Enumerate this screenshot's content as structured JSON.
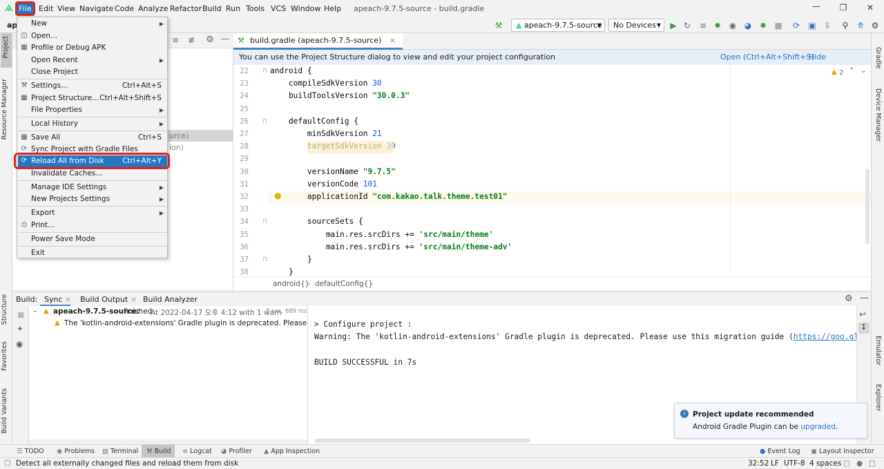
{
  "menubar": {
    "items": [
      "File",
      "Edit",
      "View",
      "Navigate",
      "Code",
      "Analyze",
      "Refactor",
      "Build",
      "Run",
      "Tools",
      "VCS",
      "Window",
      "Help"
    ],
    "window_title": "apeach-9.7.5-source - build.gradle"
  },
  "toolbar": {
    "project_crumb": "ape",
    "run_config": "apeach-9.7.5-source",
    "device": "No Devices"
  },
  "file_menu": {
    "new": "New",
    "open": "Open...",
    "profile_debug_apk": "Profile or Debug APK",
    "open_recent": "Open Recent",
    "close_project": "Close Project",
    "settings": "Settings...",
    "settings_sc": "Ctrl+Alt+S",
    "project_structure": "Project Structure...",
    "project_structure_sc": "Ctrl+Alt+Shift+S",
    "file_properties": "File Properties",
    "local_history": "Local History",
    "save_all": "Save All",
    "save_all_sc": "Ctrl+S",
    "sync_gradle": "Sync Project with Gradle Files",
    "reload_all": "Reload All from Disk",
    "reload_all_sc": "Ctrl+Alt+Y",
    "invalidate_caches": "Invalidate Caches...",
    "manage_ide": "Manage IDE Settings",
    "new_projects_settings": "New Projects Settings",
    "export": "Export",
    "print": "Print...",
    "power_save": "Power Save Mode",
    "exit": "Exit"
  },
  "project_pane": {
    "partial_1": "urce)",
    "partial_2": "ion)"
  },
  "left_strip": {
    "project": "Project",
    "resource_manager": "Resource Manager",
    "structure": "Structure",
    "favorites": "Favorites",
    "build_variants": "Build Variants"
  },
  "right_strip": {
    "gradle": "Gradle",
    "device_manager": "Device Manager",
    "emulator": "Emulator",
    "device_file_explorer": "Device File Explorer"
  },
  "editor": {
    "tab_label": "build.gradle (apeach-9.7.5-source)",
    "notification": "You can use the Project Structure dialog to view and edit your project configuration",
    "open_link": "Open (Ctrl+Alt+Shift+S)",
    "hide_link": "Hide notification",
    "warning_count": "2",
    "lines": [
      {
        "n": "22",
        "parts": [
          {
            "t": "android {",
            "c": ""
          }
        ]
      },
      {
        "n": "23",
        "parts": [
          {
            "t": "    compileSdkVersion ",
            "c": ""
          },
          {
            "t": "30",
            "c": "kw-num"
          }
        ]
      },
      {
        "n": "24",
        "parts": [
          {
            "t": "    buildToolsVersion ",
            "c": ""
          },
          {
            "t": "\"30.0.3\"",
            "c": "kw-str"
          }
        ]
      },
      {
        "n": "25",
        "parts": [
          {
            "t": "",
            "c": ""
          }
        ]
      },
      {
        "n": "26",
        "parts": [
          {
            "t": "    defaultConfig {",
            "c": ""
          }
        ]
      },
      {
        "n": "27",
        "parts": [
          {
            "t": "        minSdkVersion ",
            "c": ""
          },
          {
            "t": "21",
            "c": "kw-num"
          }
        ]
      },
      {
        "n": "28",
        "parts": [
          {
            "t": "        targetSdkVersion ",
            "c": ""
          },
          {
            "t": "30",
            "c": "kw-num"
          }
        ]
      },
      {
        "n": "29",
        "parts": [
          {
            "t": "",
            "c": ""
          }
        ]
      },
      {
        "n": "30",
        "parts": [
          {
            "t": "        versionName ",
            "c": ""
          },
          {
            "t": "\"9.7.5\"",
            "c": "kw-str"
          }
        ]
      },
      {
        "n": "31",
        "parts": [
          {
            "t": "        versionCode ",
            "c": ""
          },
          {
            "t": "101",
            "c": "kw-num"
          }
        ]
      },
      {
        "n": "32",
        "parts": [
          {
            "t": "        applicationId ",
            "c": ""
          },
          {
            "t": "\"com.kakao.talk.theme.test01\"",
            "c": "kw-str"
          }
        ]
      },
      {
        "n": "33",
        "parts": [
          {
            "t": "",
            "c": ""
          }
        ]
      },
      {
        "n": "34",
        "parts": [
          {
            "t": "        sourceSets {",
            "c": ""
          }
        ]
      },
      {
        "n": "35",
        "parts": [
          {
            "t": "            main.res.srcDirs += ",
            "c": ""
          },
          {
            "t": "'src/main/theme'",
            "c": "kw-str"
          }
        ]
      },
      {
        "n": "36",
        "parts": [
          {
            "t": "            main.res.srcDirs += ",
            "c": ""
          },
          {
            "t": "'src/main/theme-adv'",
            "c": "kw-str"
          }
        ]
      },
      {
        "n": "37",
        "parts": [
          {
            "t": "        }",
            "c": ""
          }
        ]
      },
      {
        "n": "38",
        "parts": [
          {
            "t": "    }",
            "c": ""
          }
        ]
      }
    ],
    "breadcrumb_1": "android{}",
    "breadcrumb_2": "defaultConfig{}"
  },
  "build": {
    "label": "Build:",
    "tabs": [
      "Sync",
      "Build Output",
      "Build Analyzer"
    ],
    "tree_title": "apeach-9.7.5-source:",
    "tree_status": "finished",
    "tree_time": "At 2022-04-17 오후 4:12 with 1 warn",
    "tree_duration": "8 sec, 689 ms",
    "tree_warning": "The 'kotlin-android-extensions' Gradle plugin is deprecated. Please use this m",
    "console_lines": [
      "> Configure project :",
      "Warning: The 'kotlin-android-extensions' Gradle plugin is deprecated. Please use this migration guide (",
      "",
      "BUILD SUCCESSFUL in 7s"
    ],
    "console_link": "https://goo.gle"
  },
  "notification": {
    "title": "Project update recommended",
    "body": "Android Gradle Plugin can be ",
    "link": "upgraded",
    "suffix": "."
  },
  "bottom_bar": {
    "todo": "TODO",
    "problems": "Problems",
    "terminal": "Terminal",
    "build": "Build",
    "logcat": "Logcat",
    "profiler": "Profiler",
    "app_inspection": "App Inspection",
    "event_log": "Event Log",
    "layout_inspector": "Layout Inspector"
  },
  "status_bar": {
    "message": "Detect all externally changed files and reload them from disk",
    "position": "32:52",
    "line_sep": "LF",
    "encoding": "UTF-8",
    "indent": "4 spaces"
  },
  "colors": {
    "accent": "#2675bf",
    "highlight_outline": "#e0211f",
    "string": "#067d17",
    "number": "#1750eb"
  }
}
